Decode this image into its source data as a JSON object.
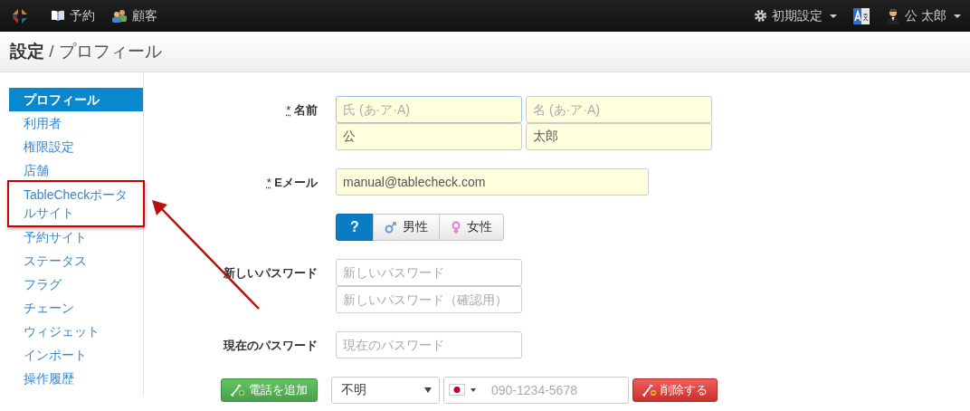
{
  "navbar": {
    "links": [
      {
        "label": "予約"
      },
      {
        "label": "顧客"
      }
    ],
    "settings_menu": "初期設定",
    "user_menu": "公 太郎"
  },
  "breadcrumb": {
    "section": "設定",
    "separator": "/",
    "page": "プロフィール"
  },
  "sidebar": {
    "items": [
      {
        "label": "プロフィール",
        "selected": true,
        "annotated": false
      },
      {
        "label": "利用者",
        "selected": false,
        "annotated": false
      },
      {
        "label": "権限設定",
        "selected": false,
        "annotated": false
      },
      {
        "label": "店舗",
        "selected": false,
        "annotated": false
      },
      {
        "label": "TableCheckポータルサイト",
        "selected": false,
        "annotated": true
      },
      {
        "label": "予約サイト",
        "selected": false,
        "annotated": false
      },
      {
        "label": "ステータス",
        "selected": false,
        "annotated": false
      },
      {
        "label": "フラグ",
        "selected": false,
        "annotated": false
      },
      {
        "label": "チェーン",
        "selected": false,
        "annotated": false
      },
      {
        "label": "ウィジェット",
        "selected": false,
        "annotated": false
      },
      {
        "label": "インポート",
        "selected": false,
        "annotated": false
      },
      {
        "label": "操作履歴",
        "selected": false,
        "annotated": false
      }
    ]
  },
  "form": {
    "rows": [
      {
        "kind": "name",
        "required_mark": "*",
        "label": "名前",
        "fields": [
          {
            "placeholder": "氏 (あ·ア·A)",
            "focused": true
          },
          {
            "placeholder": "名 (あ·ア·A)",
            "focused": false
          },
          {
            "value": "公",
            "focused": false
          },
          {
            "value": "太郎",
            "focused": false
          }
        ]
      },
      {
        "kind": "email",
        "required_mark": "*",
        "label": "Eメール",
        "fields": [
          {
            "value": "manual@tablecheck.com",
            "focused": false
          }
        ]
      },
      {
        "kind": "gender",
        "options": [
          {
            "label": "?",
            "selected": true
          },
          {
            "label": "男性",
            "selected": false
          },
          {
            "label": "女性",
            "selected": false
          }
        ]
      },
      {
        "kind": "password",
        "label": "新しいパスワード",
        "fields": [
          {
            "placeholder": "新しいパスワード",
            "focused": false
          },
          {
            "placeholder": "新しいパスワード（確認用）",
            "focused": false
          }
        ]
      },
      {
        "kind": "password",
        "label": "現在のパスワード",
        "fields": [
          {
            "placeholder": "現在のパスワード",
            "focused": false
          }
        ]
      },
      {
        "kind": "phone",
        "add_button": "電話を追加",
        "type_select": "不明",
        "phone_placeholder": "090-1234-5678",
        "delete_button": "削除する"
      }
    ]
  }
}
